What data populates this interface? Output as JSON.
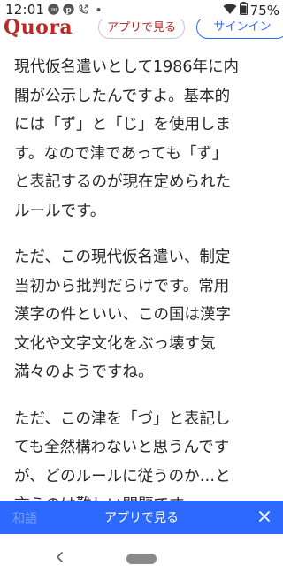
{
  "status_bar": {
    "time": "12:01",
    "battery": "75%",
    "icons": [
      "line-icon",
      "pinterest-icon",
      "call-forward-icon",
      "dot-icon",
      "wifi-icon",
      "battery-icon"
    ]
  },
  "header": {
    "logo": "Quora",
    "open_app_label": "アプリで見る",
    "sign_in_label": "サインイン",
    "brand_color": "#b92b27",
    "accent_color": "#2e69ff"
  },
  "article": {
    "paragraphs": [
      "現代仮名遣いとして1986年に内\n閣が公示したんですよ。基本的\nには「ず」と「じ」を使用しま\nす。なので津であっても「ず」\nと表記するのが現在定められた\nルールです。",
      "ただ、この現代仮名遣い、制定\n当初から批判だらけです。常用\n漢字の件といい、この国は漢字\n文化や文字文化をぶっ壊す気\n満々のようですね。",
      "ただ、この津を「づ」と表記し\nても全然構わないと思うんです\nが、どのルールに従うのか…と\n言うのは難しい問題です。"
    ]
  },
  "bottom_banner": {
    "faded_text": "和語",
    "label": "アプリで見る",
    "close_icon": "close-icon"
  },
  "nav_bar": {
    "back_icon": "back-chevron-icon",
    "home_icon": "home-pill-icon"
  }
}
